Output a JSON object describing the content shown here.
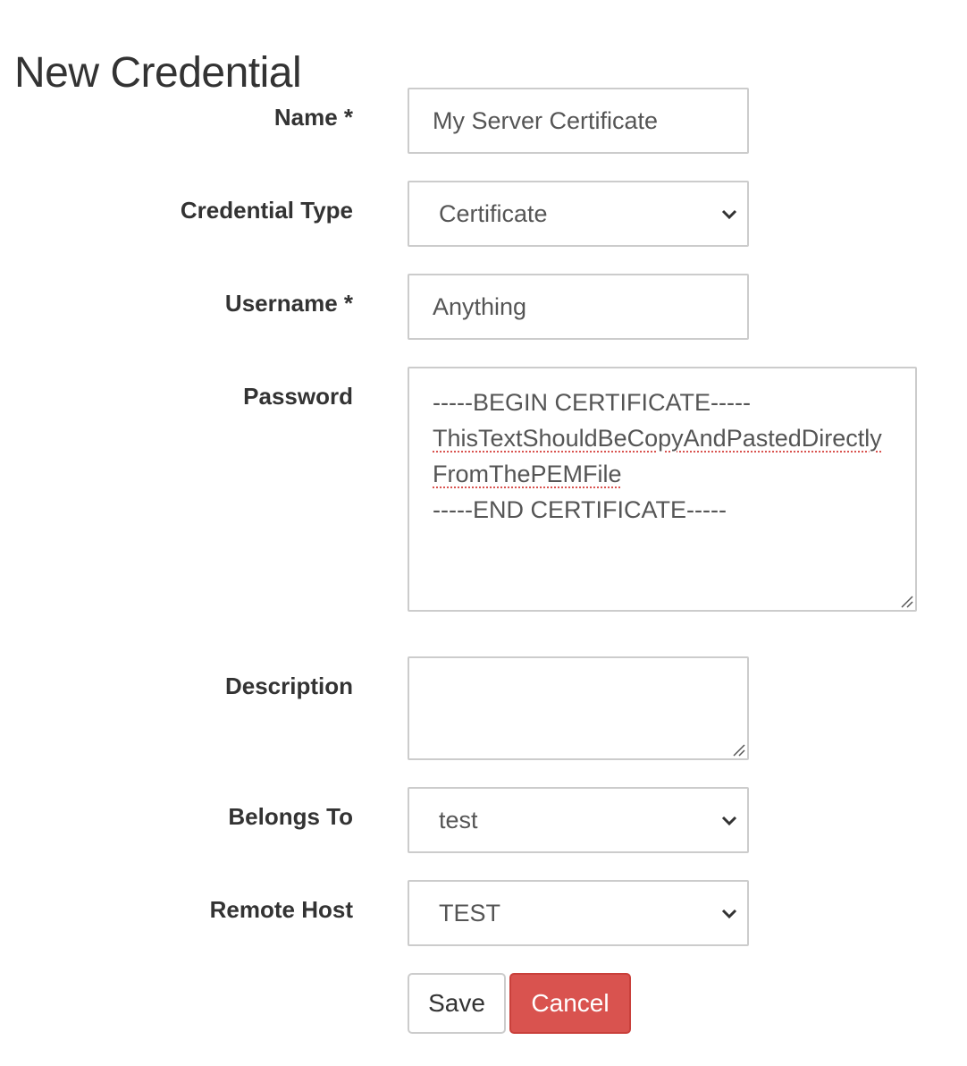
{
  "page": {
    "title": "New Credential"
  },
  "form": {
    "name": {
      "label": "Name *",
      "value": "My Server Certificate"
    },
    "credential_type": {
      "label": "Credential Type",
      "selected": "Certificate"
    },
    "username": {
      "label": "Username *",
      "value": "Anything"
    },
    "password": {
      "label": "Password",
      "lines": [
        "-----BEGIN CERTIFICATE-----",
        "ThisTextShouldBeCopyAndPastedDirectly",
        "FromThePEMFile",
        "-----END CERTIFICATE-----"
      ]
    },
    "description": {
      "label": "Description",
      "value": ""
    },
    "belongs_to": {
      "label": "Belongs To",
      "selected": "test"
    },
    "remote_host": {
      "label": "Remote Host",
      "selected": "TEST"
    }
  },
  "actions": {
    "save_label": "Save",
    "cancel_label": "Cancel"
  },
  "colors": {
    "cancel_bg": "#d9534f",
    "border": "#cccccc",
    "spellcheck": "#d9534f"
  },
  "icons": {
    "select_arrow": "chevron-down-icon",
    "resize": "resize-grip-icon"
  }
}
